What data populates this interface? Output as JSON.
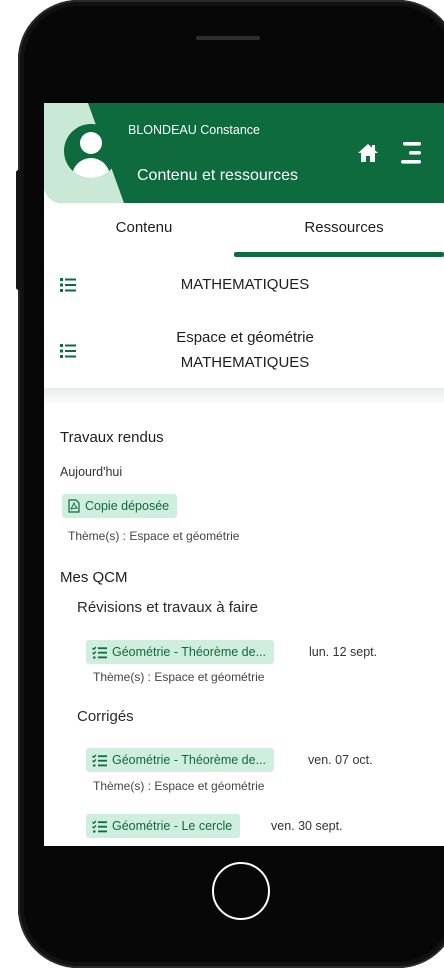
{
  "header": {
    "user_name": "BLONDEAU Constance",
    "title": "Contenu et ressources"
  },
  "tabs": [
    {
      "label": "Contenu",
      "active": false
    },
    {
      "label": "Ressources",
      "active": true
    }
  ],
  "resources": {
    "subject": "MATHEMATIQUES",
    "theme_line1": "Espace et géométrie",
    "theme_line2": "MATHEMATIQUES"
  },
  "travaux_rendus": {
    "heading": "Travaux rendus",
    "date_label": "Aujourd'hui",
    "chip": "Copie déposée",
    "theme": "Thème(s) : Espace et géométrie"
  },
  "mes_qcm": {
    "heading": "Mes QCM",
    "revisions": {
      "heading": "Révisions et travaux à faire",
      "items": [
        {
          "title": "Géométrie - Théorème de...",
          "date": "lun. 12 sept.",
          "theme": "Thème(s) : Espace et géométrie"
        }
      ]
    },
    "corriges": {
      "heading": "Corrigés",
      "items": [
        {
          "title": "Géométrie - Théorème de...",
          "date": "ven. 07 oct.",
          "theme": "Thème(s) : Espace et géométrie"
        },
        {
          "title": "Géométrie - Le cercle",
          "date": "ven. 30 sept."
        }
      ]
    }
  },
  "colors": {
    "brand": "#0e6b3d",
    "brand_light": "#c9e8d6",
    "chip_bg": "#cfeedd"
  },
  "icons": [
    "home-icon",
    "menu-icon",
    "avatar-icon",
    "list-icon",
    "pdf-icon",
    "checklist-icon"
  ]
}
